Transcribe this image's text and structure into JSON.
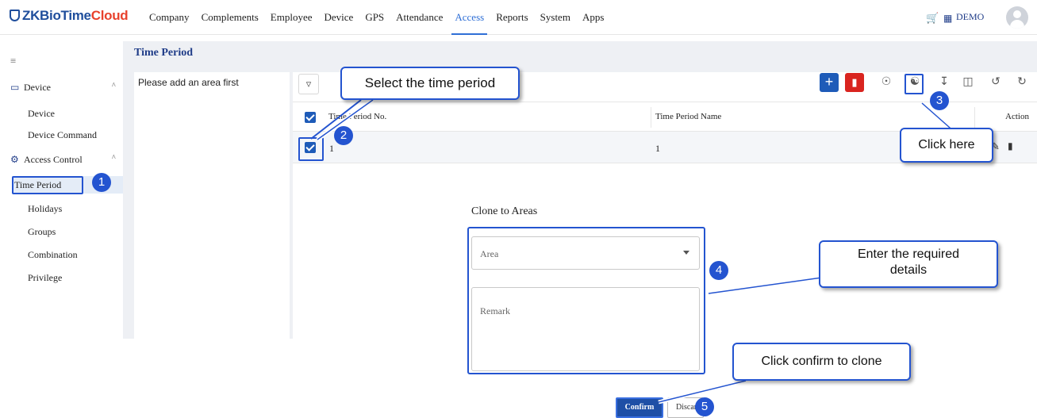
{
  "logo": {
    "brand": "ZKBioTime",
    "cloud": "Cloud"
  },
  "nav": [
    "Company",
    "Complements",
    "Employee",
    "Device",
    "GPS",
    "Attendance",
    "Access",
    "Reports",
    "System",
    "Apps"
  ],
  "nav_active": "Access",
  "user": {
    "name": "DEMO"
  },
  "sidebar": {
    "groups": [
      {
        "label": "Device",
        "items": [
          "Device",
          "Device Command"
        ]
      },
      {
        "label": "Access Control",
        "items": [
          "Time Period",
          "Holidays",
          "Groups",
          "Combination",
          "Privilege"
        ]
      }
    ],
    "active_item": "Time Period"
  },
  "page": {
    "title": "Time Period",
    "area_message": "Please add an area first"
  },
  "table": {
    "columns": [
      "Time Period No.",
      "Time Period Name",
      "Action"
    ],
    "rows": [
      {
        "no": "1",
        "name": "1",
        "checked": true
      }
    ]
  },
  "dialog": {
    "title": "Clone to Areas",
    "area_placeholder": "Area",
    "remark_placeholder": "Remark",
    "confirm_label": "Confirm",
    "discard_label": "Discard"
  },
  "callouts": {
    "select": "Select the time period",
    "click_here": "Click here",
    "enter_details": "Enter the required details",
    "confirm": "Click confirm to clone"
  },
  "badges": [
    "1",
    "2",
    "3",
    "4",
    "5"
  ],
  "colors": {
    "accent": "#2454d0",
    "brand": "#1f4e9c",
    "danger": "#d9241f",
    "primary_button": "#1e5bb8"
  }
}
